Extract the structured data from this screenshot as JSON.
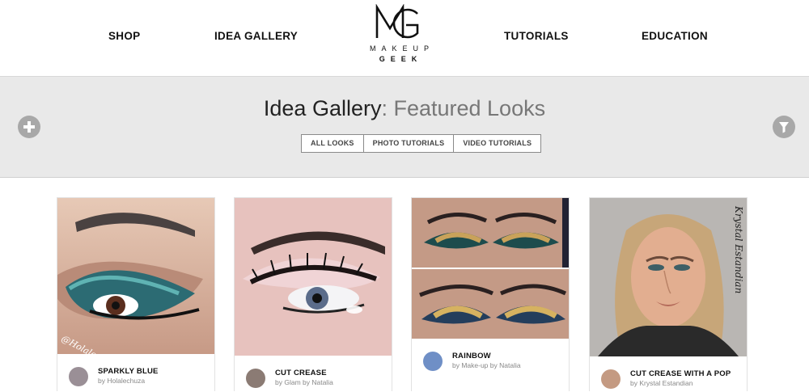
{
  "nav": {
    "shop": "SHOP",
    "idea_gallery": "IDEA GALLERY",
    "tutorials": "TUTORIALS",
    "education": "EDUCATION"
  },
  "logo": {
    "line1": "MAKEUP",
    "line2": "GEEK",
    "monogram_text": "MG"
  },
  "hero": {
    "title_main": "Idea Gallery",
    "title_sub": ": Featured Looks",
    "add_icon": "plus-icon",
    "filter_icon": "funnel-icon"
  },
  "filters": [
    "ALL LOOKS",
    "PHOTO TUTORIALS",
    "VIDEO TUTORIALS"
  ],
  "cards": [
    {
      "title": "SPARKLY BLUE",
      "by": "by Holalechuza",
      "watermark": "@Holalechuza"
    },
    {
      "title": "CUT CREASE",
      "by": "by Glam by Natalia"
    },
    {
      "title": "RAINBOW",
      "by": "by Make-up by Natalia"
    },
    {
      "title": "CUT CREASE WITH A POP",
      "by": "by Krystal Estandian",
      "watermark": "Krystal Estandian"
    }
  ],
  "colors": {
    "hero_bg": "#e9e9e9",
    "circle_button": "#a8a8a8",
    "nav_text": "#111111"
  }
}
